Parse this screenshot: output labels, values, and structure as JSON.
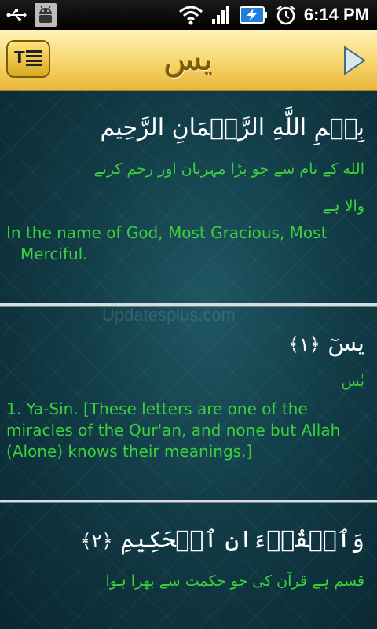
{
  "statusbar": {
    "time": "6:14 PM",
    "icons": [
      "usb-icon",
      "android-debug-icon",
      "wifi-icon",
      "signal-icon",
      "battery-charging-icon",
      "alarm-icon"
    ]
  },
  "titlebar": {
    "menu_icon": "list-menu-icon",
    "logo_text": "يس",
    "next_icon": "play-next-icon"
  },
  "verses": [
    {
      "arabic": "بِسۡمِ اللَّهِ الرَّحۡمَانِ الرَّحِيم",
      "urdu_line1": "الله کے نام سے جو بڑا مہربان اور رحم کرنے",
      "urdu_line2": "والا ہے",
      "english": "In the name of God, Most Gracious, Most Merciful."
    },
    {
      "arabic": "يسٓ",
      "number": "١",
      "urdu_line1": "یٰس",
      "english": "1. Ya-Sin. [These letters are one of the miracles of the Qur'an, and none but Allah (Alone) knows their meanings.]"
    },
    {
      "arabic": "وَٱلۡقُرۡءَانِ ٱلۡحَكِيمِ",
      "number": "٢",
      "urdu_line1": "قسم ہے قرآن کی جو حکمت سے بھرا ہوا"
    }
  ],
  "watermark": "Updatesplus.com"
}
